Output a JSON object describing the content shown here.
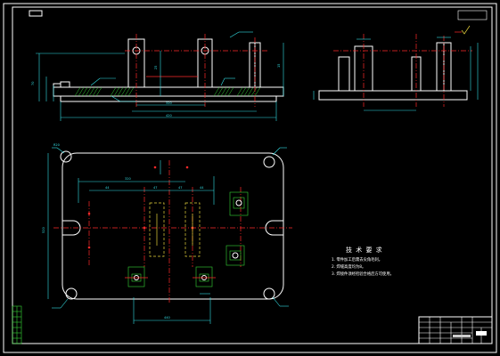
{
  "notes": {
    "title": "技 术 要 求",
    "items": [
      "1. 零件加工后需去尖角毛刺。",
      "2. 焊缝高度均为8。",
      "3. 焊接件须经检验合格后方可使用。"
    ]
  },
  "dimensions": {
    "front": [
      "320",
      "420",
      "70",
      "25",
      "15"
    ],
    "plan": [
      "440",
      "520",
      "44",
      "47",
      "47",
      "44",
      "320",
      "R20"
    ]
  },
  "colors": {
    "background": "#000000",
    "outline": "#ffffff",
    "dimension": "#33e0e6",
    "centerline": "#ff2a2a",
    "hatch": "#35d435"
  }
}
